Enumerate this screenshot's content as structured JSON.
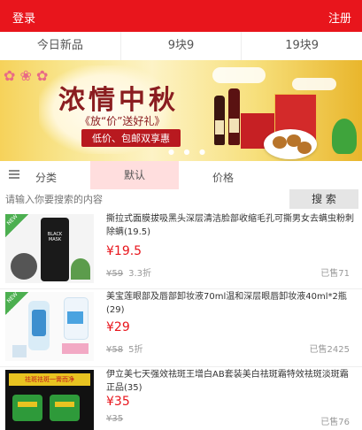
{
  "topbar": {
    "login": "登录",
    "register": "注册"
  },
  "tabs": [
    "今日新品",
    "9块9",
    "19块9"
  ],
  "banner": {
    "title": "浓情中秋",
    "subtitle": "《放“价”送好礼》",
    "promo": "低价、包邮双享惠"
  },
  "filter": {
    "category": "分类",
    "default": "默认",
    "price": "价格"
  },
  "search": {
    "placeholder": "请输入你要搜索的内容",
    "button": "搜 索"
  },
  "products": [
    {
      "name": "撕拉式面膜拔吸黑头深层清洁脸部收缩毛孔可撕男女去螨虫粉刺除螨(19.5)",
      "price": "¥19.5",
      "old_price": "¥59",
      "discount": "3.3折",
      "sold": "已售71"
    },
    {
      "name": "美宝莲眼部及唇部卸妆液70ml温和深层眼唇卸妆液40ml*2瓶(29)",
      "price": "¥29",
      "old_price": "¥58",
      "discount": "5折",
      "sold": "已售2425"
    },
    {
      "name": "伊立美七天强效祛斑王增白AB套装美白祛斑霜特效祛斑淡斑霜正品(35)",
      "price": "¥35",
      "old_price": "¥35",
      "discount": "",
      "sold": "已售76"
    }
  ],
  "thumb_texts": {
    "p1": "BLACK MASK",
    "p3": "祛斑祛斑一膏而净"
  },
  "colors": {
    "brand_red": "#e8151c",
    "tab_active": "#ffdede"
  }
}
